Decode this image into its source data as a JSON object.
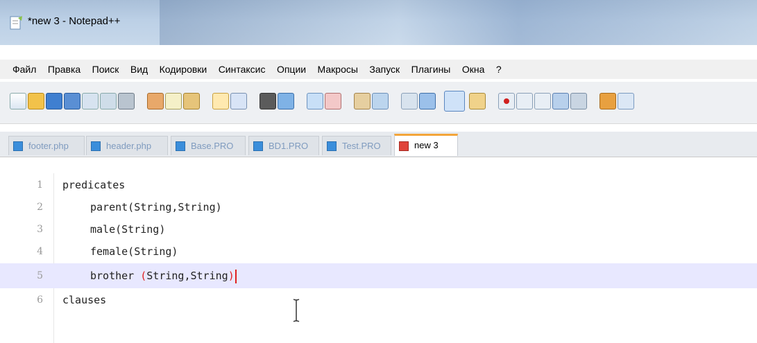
{
  "window": {
    "title": "*new 3 - Notepad++"
  },
  "menu": [
    "Файл",
    "Правка",
    "Поиск",
    "Вид",
    "Кодировки",
    "Синтаксис",
    "Опции",
    "Макросы",
    "Запуск",
    "Плагины",
    "Окна",
    "?"
  ],
  "toolbar": {
    "icons": [
      "new-file-icon",
      "open-file-icon",
      "save-icon",
      "save-all-icon",
      "close-icon",
      "close-all-icon",
      "print-icon",
      "cut-icon",
      "copy-icon",
      "paste-icon",
      "undo-icon",
      "redo-icon",
      "find-icon",
      "replace-icon",
      "zoom-in-icon",
      "zoom-out-icon",
      "sync-vertical-icon",
      "sync-horizontal-icon",
      "word-wrap-icon",
      "show-all-chars-icon",
      "indent-guide-icon",
      "document-map-icon",
      "record-macro-icon",
      "stop-macro-icon",
      "play-macro-icon",
      "run-macro-multiple-icon",
      "save-macro-icon",
      "launch-browser-icon",
      "spellcheck-icon"
    ]
  },
  "tabs": [
    {
      "label": "footer.php",
      "active": false
    },
    {
      "label": "header.php",
      "active": false
    },
    {
      "label": "Base.PRO",
      "active": false
    },
    {
      "label": "BD1.PRO",
      "active": false
    },
    {
      "label": "Test.PRO",
      "active": false
    },
    {
      "label": "new 3",
      "active": true
    }
  ],
  "editor": {
    "lines": [
      {
        "num": "1",
        "text": "predicates"
      },
      {
        "num": "2",
        "text": "parent(String,String)"
      },
      {
        "num": "3",
        "text": "male(String)"
      },
      {
        "num": "4",
        "text": "female(String)"
      },
      {
        "num": "5",
        "fn": "brother",
        "open": "(",
        "args": "String,String",
        "close": ")"
      },
      {
        "num": "6",
        "text": "clauses"
      }
    ],
    "current_line": 5
  },
  "colors": {
    "accent_tab": "#f3a53a",
    "brace_highlight": "#e02020",
    "current_line_bg": "#e8e8ff"
  }
}
